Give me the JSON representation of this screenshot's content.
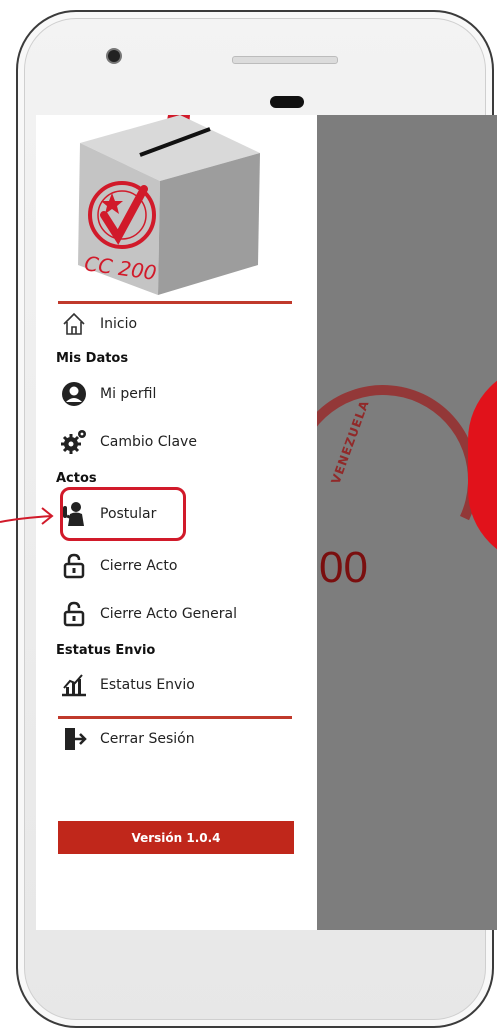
{
  "logo": {
    "text": "CC 200",
    "accent": "#d11a2a"
  },
  "background": {
    "number": "00",
    "arc_text": "VENEZUELA"
  },
  "menu": {
    "inicio": "Inicio",
    "mis_datos_header": "Mis Datos",
    "mi_perfil": "Mi perfil",
    "cambio_clave": "Cambio Clave",
    "actos_header": "Actos",
    "postular": "Postular",
    "cierre_acto": "Cierre Acto",
    "cierre_acto_general": "Cierre Acto General",
    "estatus_envio_header": "Estatus Envio",
    "estatus_envio": "Estatus Envio",
    "cerrar_sesion": "Cerrar Sesión"
  },
  "footer": {
    "version_label": "Versión 1.0.4"
  },
  "colors": {
    "brand_red": "#c0271b",
    "highlight": "#d11a2a",
    "overlay": "#7d7d7d"
  }
}
